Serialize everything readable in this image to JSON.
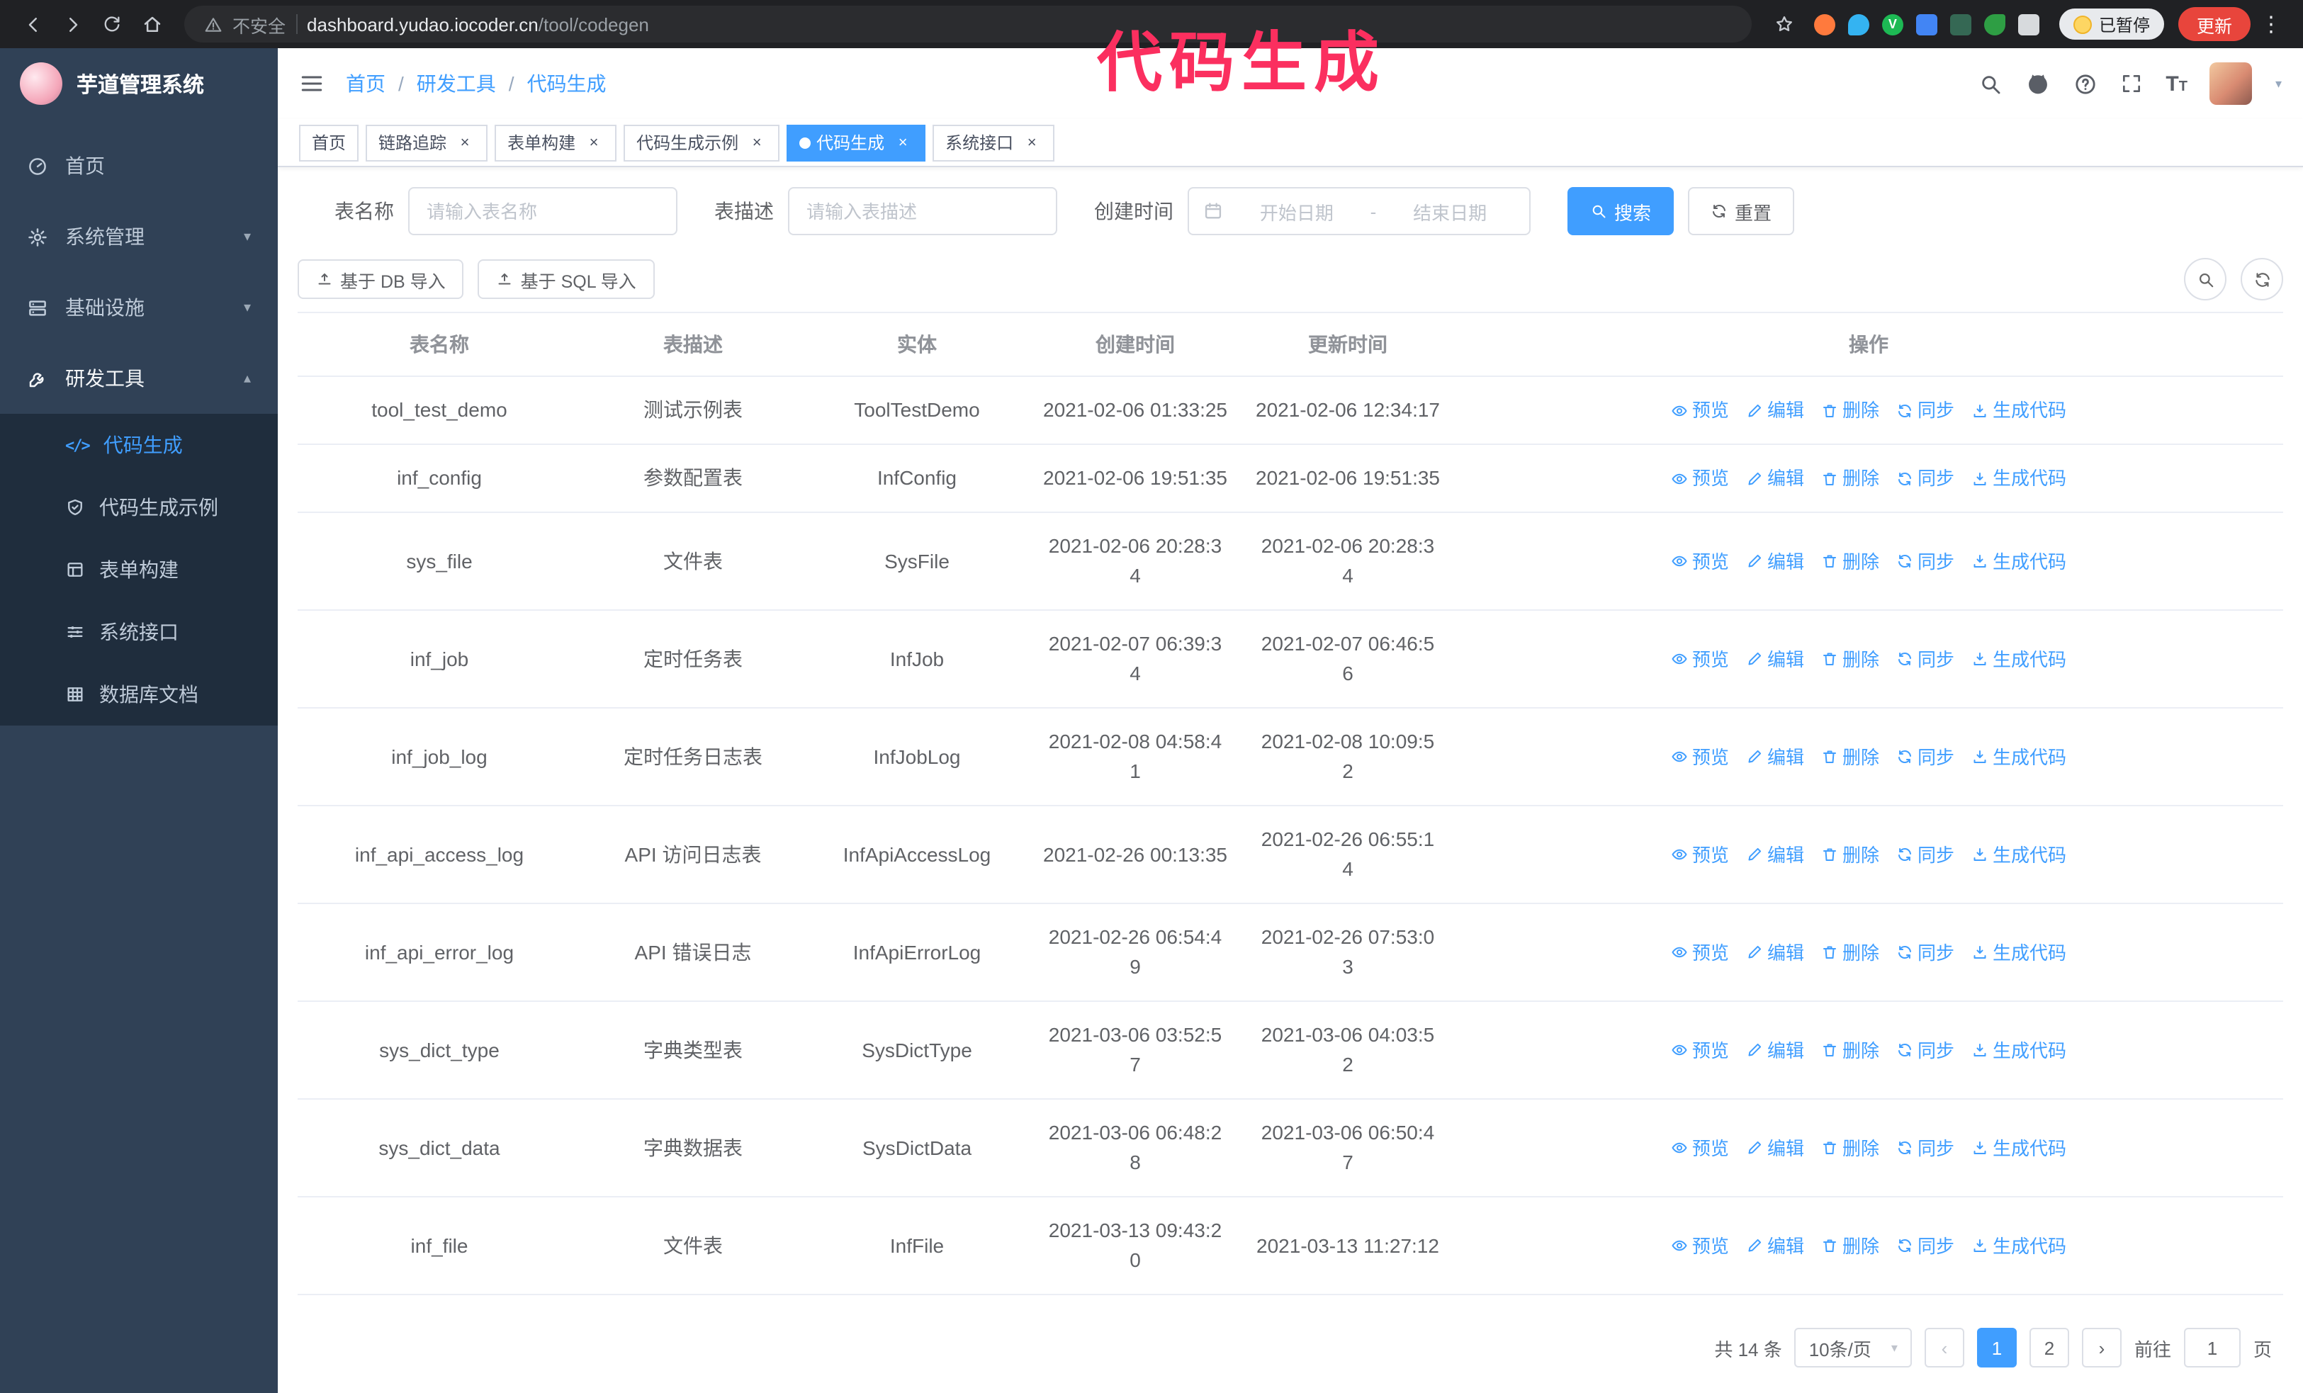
{
  "colors": {
    "primary": "#409eff",
    "sidebar_bg": "#304156",
    "submenu_bg": "#1f2d3d",
    "annotation_pink": "#fb2f5f",
    "update_button_red": "#e8453c"
  },
  "annotation": {
    "text": "代码生成"
  },
  "browser": {
    "security_label": "不安全",
    "url_host": "dashboard.yudao.iocoder.cn",
    "url_path": "/tool/codegen",
    "paused_badge": "已暂停",
    "update_button": "更新"
  },
  "sidebar": {
    "app_title": "芋道管理系统",
    "items": [
      {
        "label": "首页"
      },
      {
        "label": "系统管理"
      },
      {
        "label": "基础设施"
      },
      {
        "label": "研发工具"
      }
    ],
    "submenu": [
      {
        "label": "代码生成"
      },
      {
        "label": "代码生成示例"
      },
      {
        "label": "表单构建"
      },
      {
        "label": "系统接口"
      },
      {
        "label": "数据库文档"
      }
    ]
  },
  "header": {
    "breadcrumb": [
      "首页",
      "研发工具",
      "代码生成"
    ]
  },
  "tabs": [
    {
      "label": "首页"
    },
    {
      "label": "链路追踪"
    },
    {
      "label": "表单构建"
    },
    {
      "label": "代码生成示例"
    },
    {
      "label": "代码生成"
    },
    {
      "label": "系统接口"
    }
  ],
  "filters": {
    "table_name_label": "表名称",
    "table_name_placeholder": "请输入表名称",
    "table_desc_label": "表描述",
    "table_desc_placeholder": "请输入表描述",
    "create_time_label": "创建时间",
    "date_start_placeholder": "开始日期",
    "date_separator": "-",
    "date_end_placeholder": "结束日期",
    "search_button": "搜索",
    "reset_button": "重置"
  },
  "toolbar": {
    "import_db": "基于 DB 导入",
    "import_sql": "基于 SQL 导入"
  },
  "table": {
    "columns": [
      "表名称",
      "表描述",
      "实体",
      "创建时间",
      "更新时间",
      "操作"
    ],
    "actions": [
      "预览",
      "编辑",
      "删除",
      "同步",
      "生成代码"
    ],
    "rows": [
      {
        "name": "tool_test_demo",
        "desc": "测试示例表",
        "entity": "ToolTestDemo",
        "created": "2021-02-06 01:33:25",
        "updated": "2021-02-06 12:34:17"
      },
      {
        "name": "inf_config",
        "desc": "参数配置表",
        "entity": "InfConfig",
        "created": "2021-02-06 19:51:35",
        "updated": "2021-02-06 19:51:35"
      },
      {
        "name": "sys_file",
        "desc": "文件表",
        "entity": "SysFile",
        "created": "2021-02-06 20:28:3\n4",
        "updated": "2021-02-06 20:28:3\n4"
      },
      {
        "name": "inf_job",
        "desc": "定时任务表",
        "entity": "InfJob",
        "created": "2021-02-07 06:39:3\n4",
        "updated": "2021-02-07 06:46:5\n6"
      },
      {
        "name": "inf_job_log",
        "desc": "定时任务日志表",
        "entity": "InfJobLog",
        "created": "2021-02-08 04:58:4\n1",
        "updated": "2021-02-08 10:09:5\n2"
      },
      {
        "name": "inf_api_access_log",
        "desc": "API 访问日志表",
        "entity": "InfApiAccessLog",
        "created": "2021-02-26 00:13:35",
        "updated": "2021-02-26 06:55:1\n4"
      },
      {
        "name": "inf_api_error_log",
        "desc": "API 错误日志",
        "entity": "InfApiErrorLog",
        "created": "2021-02-26 06:54:4\n9",
        "updated": "2021-02-26 07:53:0\n3"
      },
      {
        "name": "sys_dict_type",
        "desc": "字典类型表",
        "entity": "SysDictType",
        "created": "2021-03-06 03:52:5\n7",
        "updated": "2021-03-06 04:03:5\n2"
      },
      {
        "name": "sys_dict_data",
        "desc": "字典数据表",
        "entity": "SysDictData",
        "created": "2021-03-06 06:48:2\n8",
        "updated": "2021-03-06 06:50:4\n7"
      },
      {
        "name": "inf_file",
        "desc": "文件表",
        "entity": "InfFile",
        "created": "2021-03-13 09:43:2\n0",
        "updated": "2021-03-13 11:27:12"
      }
    ]
  },
  "pagination": {
    "total": "共 14 条",
    "page_size": "10条/页",
    "page_1": "1",
    "page_2": "2",
    "goto_label": "前往",
    "goto_value": "1",
    "goto_unit": "页"
  }
}
